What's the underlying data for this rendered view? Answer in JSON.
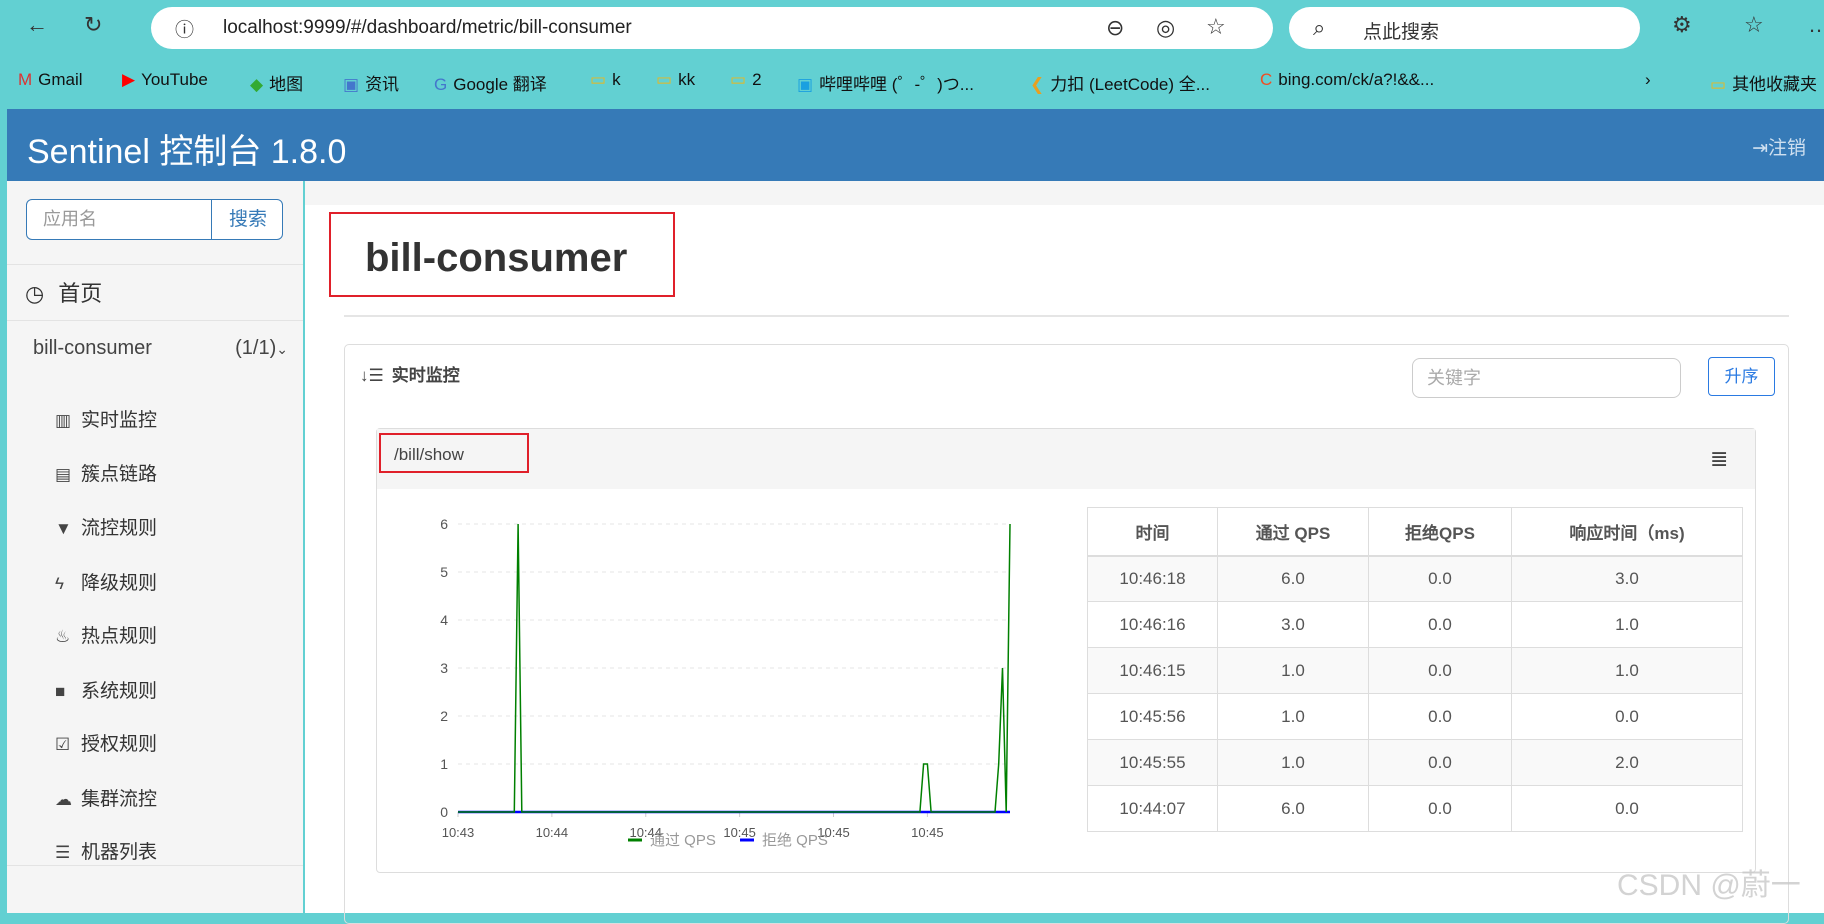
{
  "browser": {
    "url": "localhost:9999/#/dashboard/metric/bill-consumer",
    "search_placeholder": "点此搜索",
    "bookmarks": [
      "Gmail",
      "YouTube",
      "地图",
      "资讯",
      "Google 翻译",
      "k",
      "kk",
      "2",
      "哔哩哔哩 (゜-゜)つ...",
      "力扣 (LeetCode) 全...",
      "bing.com/ck/a?!&&...",
      "其他收藏夹"
    ]
  },
  "header": {
    "brand": "Sentinel 控制台 1.8.0",
    "logout": "注销"
  },
  "sidebar": {
    "search_placeholder": "应用名",
    "search_button": "搜索",
    "home": "首页",
    "app": {
      "name": "bill-consumer",
      "count": "(1/1)"
    },
    "items": [
      {
        "label": "实时监控",
        "icon": "bar-chart-icon"
      },
      {
        "label": "簇点链路",
        "icon": "list-alt-icon"
      },
      {
        "label": "流控规则",
        "icon": "filter-icon"
      },
      {
        "label": "降级规则",
        "icon": "flash-icon"
      },
      {
        "label": "热点规则",
        "icon": "fire-icon"
      },
      {
        "label": "系统规则",
        "icon": "lock-icon"
      },
      {
        "label": "授权规则",
        "icon": "check-icon"
      },
      {
        "label": "集群流控",
        "icon": "cloud-icon"
      },
      {
        "label": "机器列表",
        "icon": "th-list-icon"
      }
    ]
  },
  "main": {
    "title": "bill-consumer",
    "panel_title": "实时监控",
    "keyword_placeholder": "关键字",
    "sort_button": "升序",
    "resource": "/bill/show",
    "table": {
      "headers": [
        "时间",
        "通过 QPS",
        "拒绝QPS",
        "响应时间（ms)"
      ],
      "rows": [
        [
          "10:46:18",
          "6.0",
          "0.0",
          "3.0"
        ],
        [
          "10:46:16",
          "3.0",
          "0.0",
          "1.0"
        ],
        [
          "10:46:15",
          "1.0",
          "0.0",
          "1.0"
        ],
        [
          "10:45:56",
          "1.0",
          "0.0",
          "0.0"
        ],
        [
          "10:45:55",
          "1.0",
          "0.0",
          "2.0"
        ],
        [
          "10:44:07",
          "6.0",
          "0.0",
          "0.0"
        ]
      ]
    }
  },
  "chart_data": {
    "type": "line",
    "xlim": [
      "10:43:51",
      "10:46:18"
    ],
    "ylim": [
      0,
      6
    ],
    "yticks": [
      0,
      1,
      2,
      3,
      4,
      5,
      6
    ],
    "xticks": [
      {
        "t": "10:43:51",
        "label": "10:43"
      },
      {
        "t": "10:44:16",
        "label": "10:44"
      },
      {
        "t": "10:44:41",
        "label": "10:44"
      },
      {
        "t": "10:45:06",
        "label": "10:45"
      },
      {
        "t": "10:45:31",
        "label": "10:45"
      },
      {
        "t": "10:45:56",
        "label": "10:45"
      }
    ],
    "grid": "horizontal-dashed",
    "legend_position": "bottom",
    "series": [
      {
        "name": "通过 QPS",
        "color": "#008000",
        "points": [
          [
            "10:44:07",
            6
          ],
          [
            "10:45:55",
            1
          ],
          [
            "10:45:56",
            1
          ],
          [
            "10:46:15",
            1
          ],
          [
            "10:46:16",
            3
          ],
          [
            "10:46:18",
            6
          ]
        ]
      },
      {
        "name": "拒绝 QPS",
        "color": "#0000ff",
        "points": []
      }
    ]
  },
  "watermark": "CSDN @蔚一"
}
